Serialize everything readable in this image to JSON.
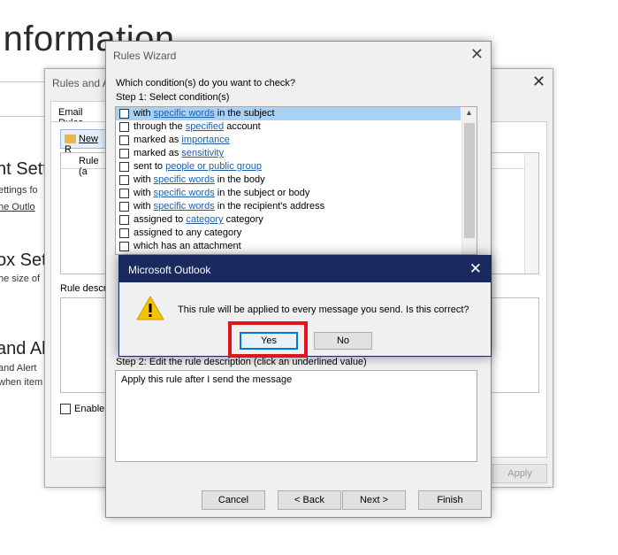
{
  "background": {
    "title": "Information",
    "headings": [
      "nt Sett",
      "ox Sett",
      "and Al"
    ],
    "texts": [
      "ettings fo",
      "he Outlo",
      "he size of",
      "and Alert",
      "when item"
    ]
  },
  "rules_alerts": {
    "title": "Rules and A",
    "tab": "Email Rules",
    "new_rule_label": "New R",
    "column_rule": "Rule (a",
    "desc_label": "Rule descr",
    "enable_label": "Enable",
    "apply_label": "Apply"
  },
  "wizard": {
    "title": "Rules Wizard",
    "question": "Which condition(s) do you want to check?",
    "step1": "Step 1: Select condition(s)",
    "conditions": [
      {
        "pre": "with ",
        "link": "specific words",
        "post": " in the subject"
      },
      {
        "pre": "through the ",
        "link": "specified",
        "post": " account"
      },
      {
        "pre": "marked as ",
        "link": "importance",
        "post": ""
      },
      {
        "pre": "marked as ",
        "link": "sensitivity",
        "post": ""
      },
      {
        "pre": "sent to ",
        "link": "people or public group",
        "post": ""
      },
      {
        "pre": "with ",
        "link": "specific words",
        "post": " in the body"
      },
      {
        "pre": "with ",
        "link": "specific words",
        "post": " in the subject or body"
      },
      {
        "pre": "with ",
        "link": "specific words",
        "post": " in the recipient's address"
      },
      {
        "pre": "assigned to ",
        "link": "category",
        "post": " category"
      },
      {
        "pre": "assigned to any category",
        "link": "",
        "post": ""
      },
      {
        "pre": "which has an attachment",
        "link": "",
        "post": ""
      }
    ],
    "step2": "Step 2: Edit the rule description (click an underlined value)",
    "description": "Apply this rule after I send the message",
    "buttons": {
      "cancel": "Cancel",
      "back": "< Back",
      "next": "Next >",
      "finish": "Finish"
    }
  },
  "msgbox": {
    "title": "Microsoft Outlook",
    "message": "This rule will be applied to every message you send. Is this correct?",
    "yes": "Yes",
    "no": "No",
    "close_glyph": "✕"
  },
  "icons": {
    "close": "close-icon",
    "warning": "warning-icon",
    "folder": "folder-icon",
    "scroll_up": "scroll-up-icon"
  },
  "colors": {
    "titlebar": "#1b2a5e",
    "selection": "#a9d0f5",
    "link": "#1f5fa8",
    "highlight": "#e0141e",
    "warning": "#f5c400"
  }
}
